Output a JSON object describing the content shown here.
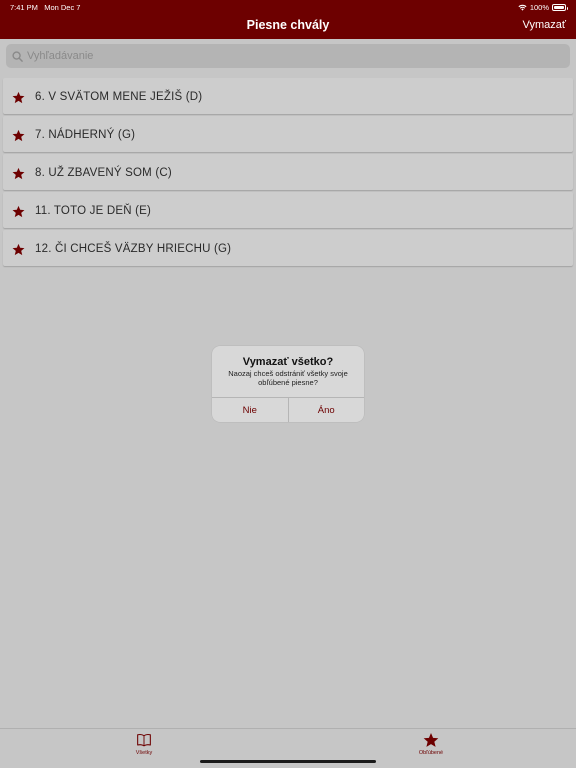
{
  "status": {
    "time": "7:41 PM",
    "date": "Mon Dec 7",
    "battery": "100%"
  },
  "nav": {
    "title": "Piesne chvály",
    "action": "Vymazať"
  },
  "search": {
    "placeholder": "Vyhľadávanie"
  },
  "favorites": [
    "6. V SVÄTOM MENE JEŽIŠ (D)",
    "7. NÁDHERNÝ (G)",
    "8. UŽ ZBAVENÝ SOM (C)",
    "11. TOTO JE DEŇ (E)",
    "12. ČI CHCEŠ VÄZBY HRIECHU (G)"
  ],
  "alert": {
    "title": "Vymazať všetko?",
    "message": "Naozaj chceš odstrániť všetky svoje obľúbené piesne?",
    "no": "Nie",
    "yes": "Áno"
  },
  "tabs": {
    "all": {
      "label": "Všetky",
      "icon": "book-icon"
    },
    "favorites": {
      "label": "Obľúbené",
      "icon": "star-icon"
    }
  },
  "colors": {
    "accent": "#6d0000",
    "background": "#c6c6c6"
  }
}
